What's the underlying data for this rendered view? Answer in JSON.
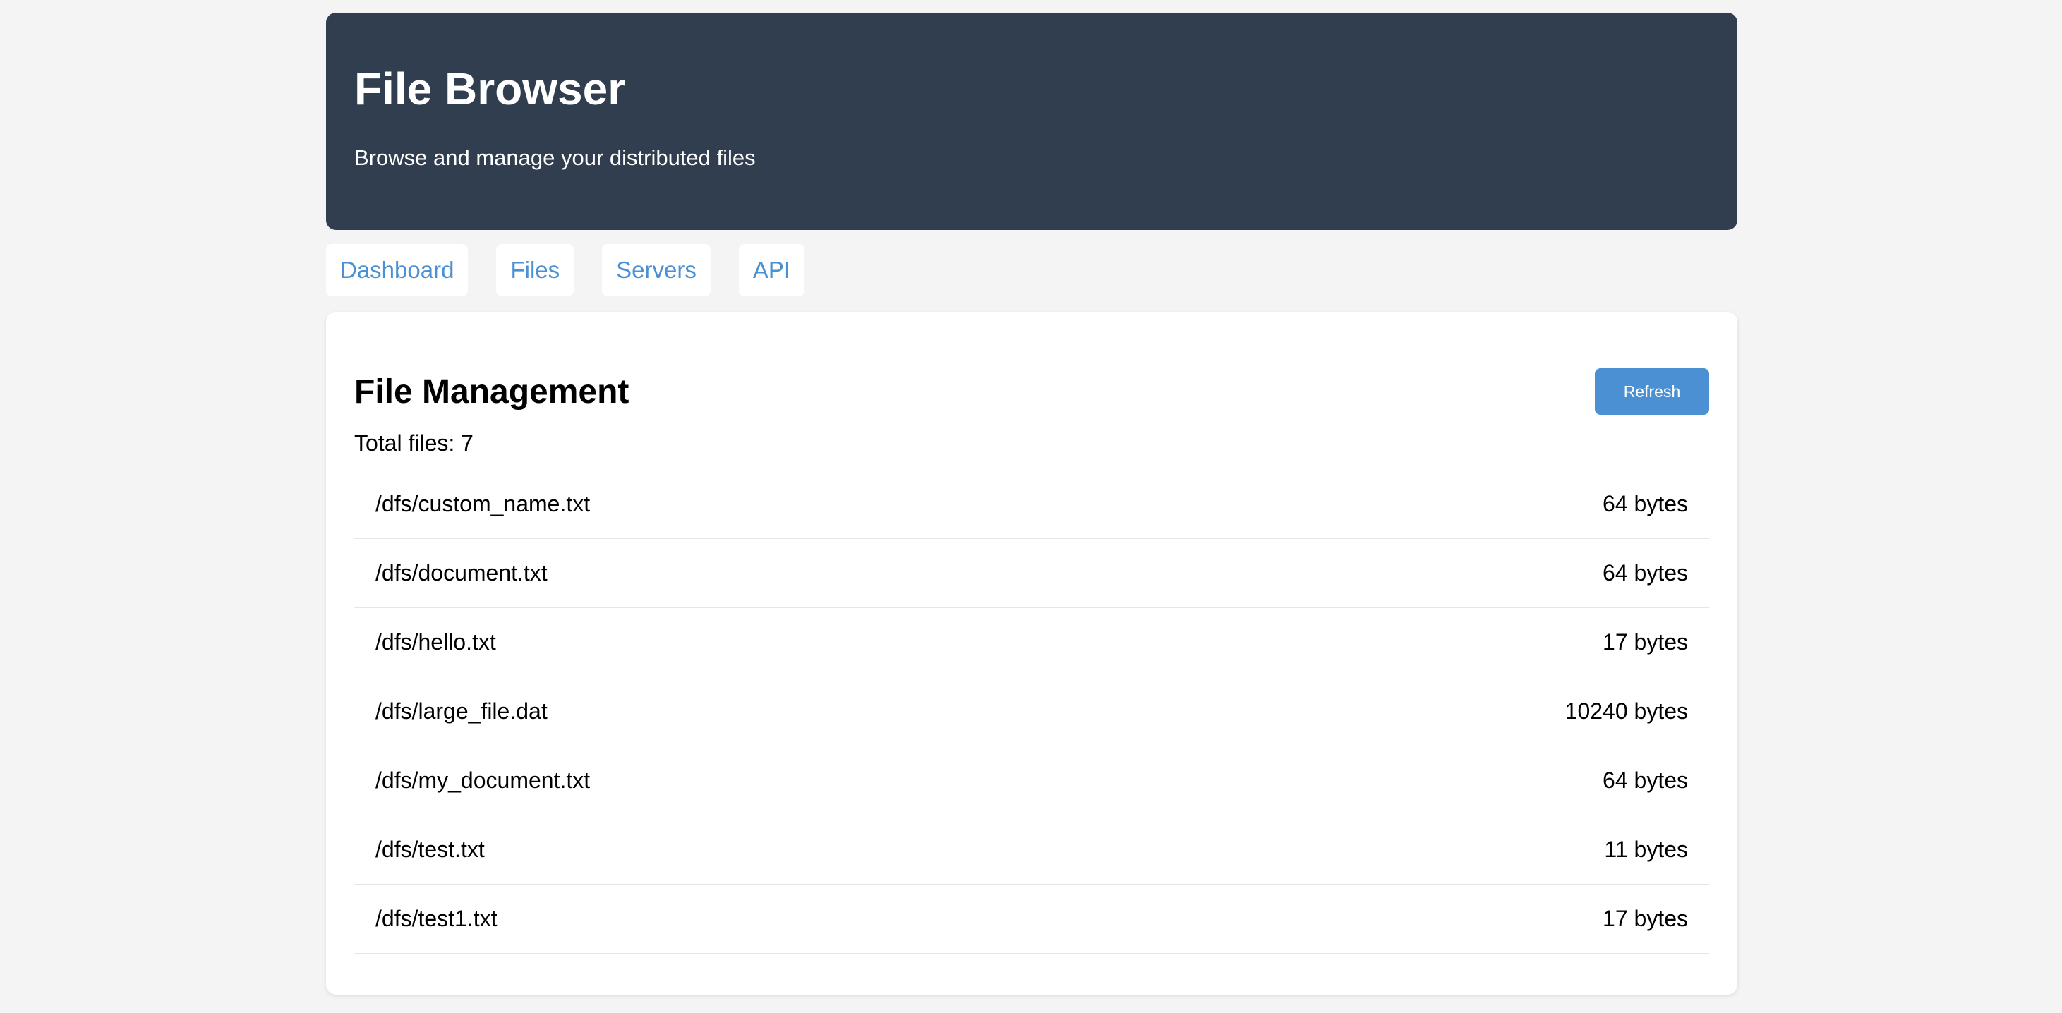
{
  "header": {
    "title": "File Browser",
    "subtitle": "Browse and manage your distributed files"
  },
  "nav": {
    "items": [
      {
        "label": "Dashboard"
      },
      {
        "label": "Files"
      },
      {
        "label": "Servers"
      },
      {
        "label": "API"
      }
    ]
  },
  "main": {
    "title": "File Management",
    "refresh_label": "Refresh",
    "total_label": "Total files: 7",
    "files": [
      {
        "path": "/dfs/custom_name.txt",
        "size": "64 bytes"
      },
      {
        "path": "/dfs/document.txt",
        "size": "64 bytes"
      },
      {
        "path": "/dfs/hello.txt",
        "size": "17 bytes"
      },
      {
        "path": "/dfs/large_file.dat",
        "size": "10240 bytes"
      },
      {
        "path": "/dfs/my_document.txt",
        "size": "64 bytes"
      },
      {
        "path": "/dfs/test.txt",
        "size": "11 bytes"
      },
      {
        "path": "/dfs/test1.txt",
        "size": "17 bytes"
      }
    ]
  },
  "colors": {
    "header_bg": "#313e4f",
    "accent": "#4a90d2",
    "page_bg": "#f4f4f4"
  }
}
